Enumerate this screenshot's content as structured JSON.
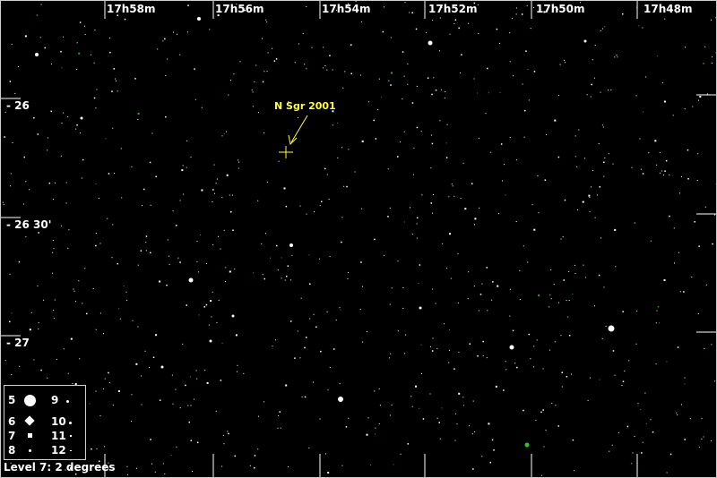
{
  "ra_labels": [
    "17h58m",
    "17h56m",
    "17h54m",
    "17h52m",
    "17h50m",
    "17h48m"
  ],
  "dec_labels": [
    "- 26",
    "- 26 30'",
    "- 27"
  ],
  "target": {
    "label": "N Sgr 2001",
    "color": "#ffff33"
  },
  "legend": {
    "items": [
      {
        "mag": "5",
        "symbol": "large-circle"
      },
      {
        "mag": "6",
        "symbol": "diamond"
      },
      {
        "mag": "7",
        "symbol": "small-square"
      },
      {
        "mag": "8",
        "symbol": "tiny-dot"
      },
      {
        "mag": "9",
        "symbol": "dot"
      },
      {
        "mag": "10",
        "symbol": "dot"
      },
      {
        "mag": "11",
        "symbol": "dot"
      },
      {
        "mag": "12",
        "symbol": "dot"
      }
    ]
  },
  "scale_label": "Level 7: 2 degrees",
  "colors": {
    "background": "#000000",
    "stars": "#ffffff",
    "target": "#ffff33",
    "highlight_star": "#22cc22"
  }
}
